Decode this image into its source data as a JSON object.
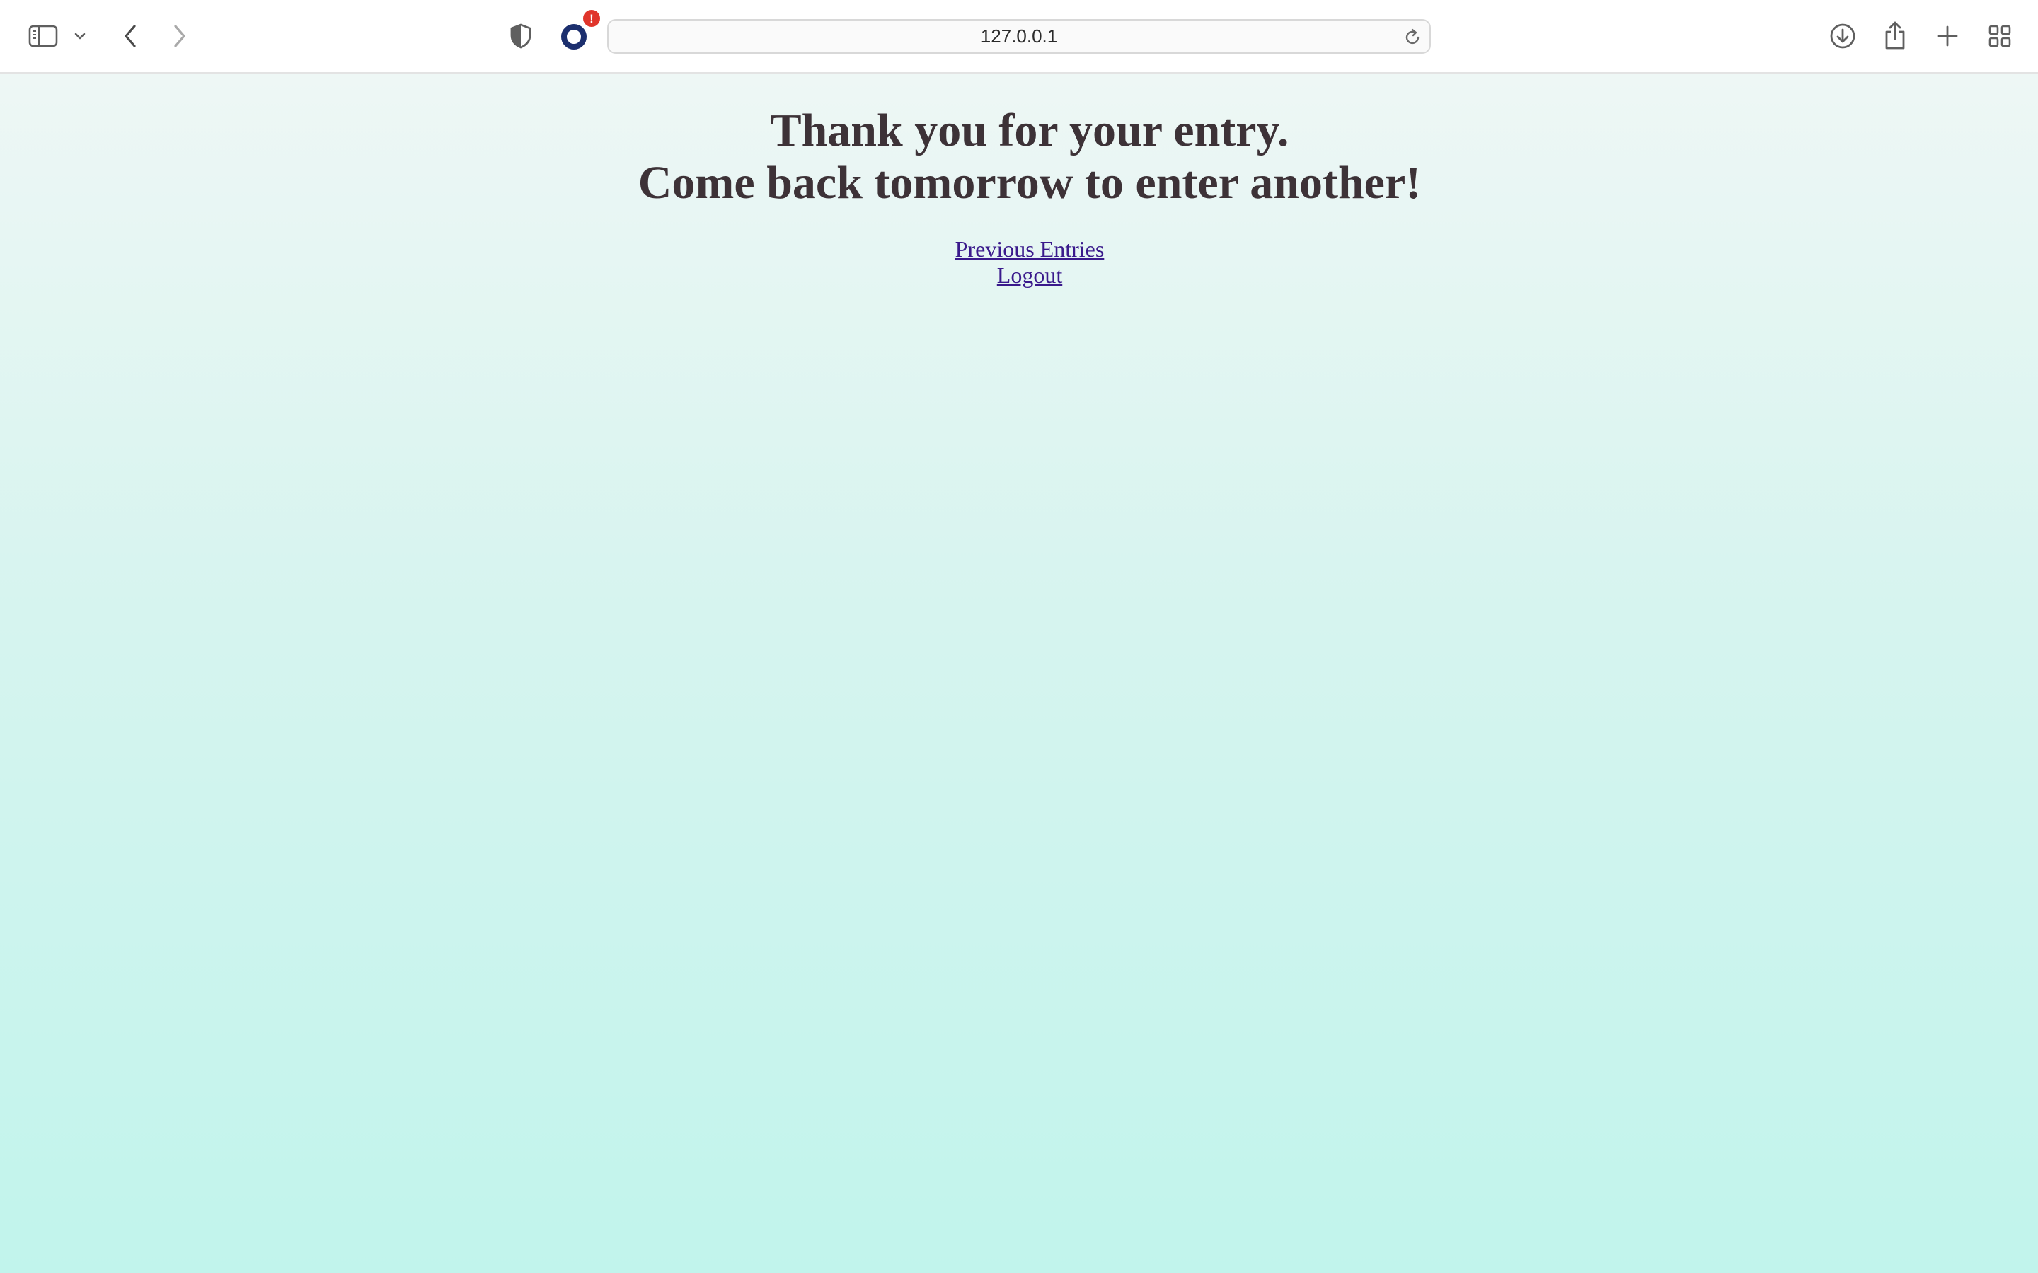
{
  "browser": {
    "address": "127.0.0.1",
    "extension_badge": "!",
    "icons": {
      "sidebar": "sidebar-icon",
      "sidebar_menu": "chevron-down-icon",
      "back": "chevron-left-icon",
      "forward": "chevron-right-icon",
      "privacy": "shield-icon",
      "extension": "ring-icon",
      "reload": "reload-icon",
      "downloads": "download-icon",
      "share": "share-icon",
      "new_tab": "plus-icon",
      "tab_overview": "grid-icon"
    }
  },
  "page": {
    "heading_line1": "Thank you for your entry.",
    "heading_line2": "Come back tomorrow to enter another!",
    "links": {
      "previous_entries": "Previous Entries",
      "logout": "Logout"
    }
  },
  "colors": {
    "heading": "#3d3237",
    "link": "#3a1a8c",
    "background_top": "#eef7f5",
    "background_bottom": "#c1f4ec",
    "badge": "#e0352b",
    "extension_ring": "#1c2f6e"
  }
}
